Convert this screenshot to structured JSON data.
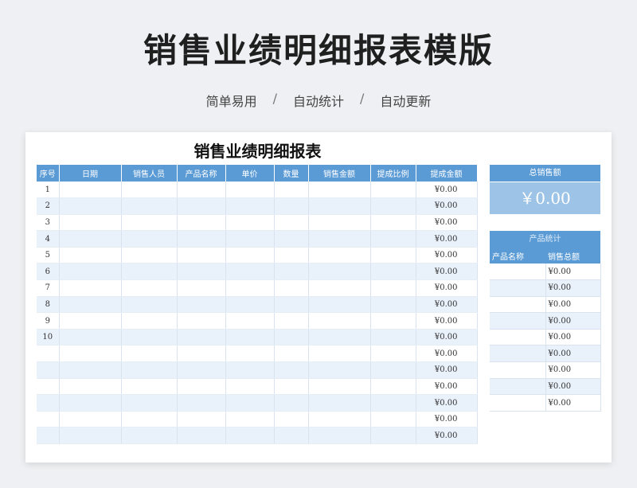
{
  "hero": {
    "title": "销售业绩明细报表模版",
    "tags": [
      "简单易用",
      "自动统计",
      "自动更新"
    ],
    "separator": "/"
  },
  "sheet": {
    "title": "销售业绩明细报表",
    "columns": [
      "序号",
      "日期",
      "销售人员",
      "产品名称",
      "单价",
      "数量",
      "销售金额",
      "提成比例",
      "提成金额"
    ],
    "rows": [
      {
        "index": "1",
        "commission": "¥0.00"
      },
      {
        "index": "2",
        "commission": "¥0.00"
      },
      {
        "index": "3",
        "commission": "¥0.00"
      },
      {
        "index": "4",
        "commission": "¥0.00"
      },
      {
        "index": "5",
        "commission": "¥0.00"
      },
      {
        "index": "6",
        "commission": "¥0.00"
      },
      {
        "index": "7",
        "commission": "¥0.00"
      },
      {
        "index": "8",
        "commission": "¥0.00"
      },
      {
        "index": "9",
        "commission": "¥0.00"
      },
      {
        "index": "10",
        "commission": "¥0.00"
      },
      {
        "index": "",
        "commission": "¥0.00"
      },
      {
        "index": "",
        "commission": "¥0.00"
      },
      {
        "index": "",
        "commission": "¥0.00"
      },
      {
        "index": "",
        "commission": "¥0.00"
      },
      {
        "index": "",
        "commission": "¥0.00"
      },
      {
        "index": "",
        "commission": "¥0.00"
      }
    ]
  },
  "total": {
    "label": "总销售额",
    "value": "￥0.00"
  },
  "product_stats": {
    "title": "产品统计",
    "col_name": "产品名称",
    "col_sales": "销售总额",
    "rows": [
      "¥0.00",
      "¥0.00",
      "¥0.00",
      "¥0.00",
      "¥0.00",
      "¥0.00",
      "¥0.00",
      "¥0.00",
      "¥0.00"
    ]
  },
  "colors": {
    "header_blue": "#5b9bd5",
    "light_blue": "#9dc3e6",
    "row_alt": "#e9f1fb"
  }
}
